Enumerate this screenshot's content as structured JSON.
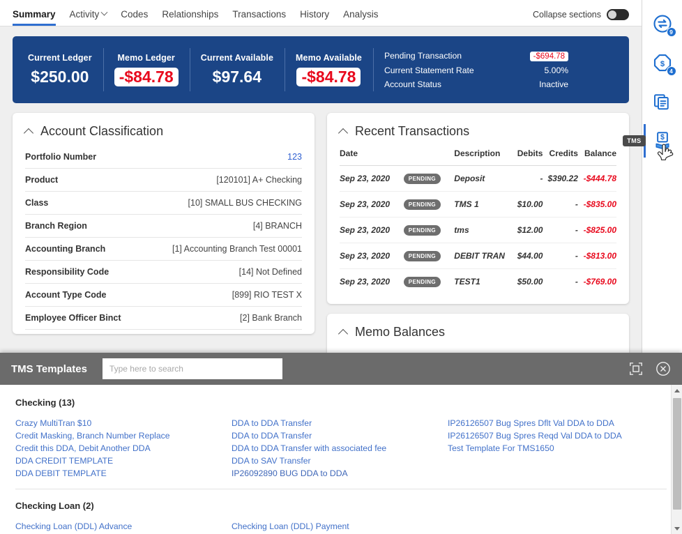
{
  "tabs": [
    {
      "label": "Summary",
      "active": true,
      "caret": false
    },
    {
      "label": "Activity",
      "active": false,
      "caret": true
    },
    {
      "label": "Codes",
      "active": false,
      "caret": false
    },
    {
      "label": "Relationships",
      "active": false,
      "caret": false
    },
    {
      "label": "Transactions",
      "active": false,
      "caret": false
    },
    {
      "label": "History",
      "active": false,
      "caret": false
    },
    {
      "label": "Analysis",
      "active": false,
      "caret": false
    }
  ],
  "header": {
    "collapse_label": "Collapse sections",
    "collapse_state": "off"
  },
  "banner": {
    "accent_color": "#1b4586",
    "negative_color": "#e8081c",
    "cells": [
      {
        "label": "Current Ledger",
        "value": "$250.00",
        "negative": false
      },
      {
        "label": "Memo Ledger",
        "value": "-$84.78",
        "negative": true
      },
      {
        "label": "Current Available",
        "value": "$97.64",
        "negative": false
      },
      {
        "label": "Memo Available",
        "value": "-$84.78",
        "negative": true
      }
    ],
    "info": [
      {
        "key": "Pending Transaction",
        "value": "-$694.78",
        "negative": true
      },
      {
        "key": "Current Statement Rate",
        "value": "5.00%",
        "negative": false
      },
      {
        "key": "Account Status",
        "value": "Inactive",
        "negative": false
      }
    ]
  },
  "account_classification": {
    "title": "Account Classification",
    "rows": [
      {
        "key": "Portfolio Number",
        "value": "123",
        "link": true
      },
      {
        "key": "Product",
        "value": "[120101] A+ Checking",
        "link": false
      },
      {
        "key": "Class",
        "value": "[10] SMALL BUS CHECKING",
        "link": false
      },
      {
        "key": "Branch Region",
        "value": "[4] BRANCH",
        "link": false
      },
      {
        "key": "Accounting Branch",
        "value": "[1] Accounting Branch Test 00001",
        "link": false
      },
      {
        "key": "Responsibility Code",
        "value": "[14] Not Defined",
        "link": false
      },
      {
        "key": "Account Type Code",
        "value": "[899] RIO TEST X",
        "link": false
      },
      {
        "key": "Employee Officer Binct",
        "value": "[2] Bank Branch",
        "link": false
      }
    ]
  },
  "recent_transactions": {
    "title": "Recent Transactions",
    "columns": [
      "Date",
      "Description",
      "Debits",
      "Credits",
      "Balance"
    ],
    "rows": [
      {
        "date": "Sep 23, 2020",
        "status": "PENDING",
        "description": "Deposit",
        "debits": "-",
        "credits": "$390.22",
        "balance": "-$444.78"
      },
      {
        "date": "Sep 23, 2020",
        "status": "PENDING",
        "description": "TMS 1",
        "debits": "$10.00",
        "credits": "-",
        "balance": "-$835.00"
      },
      {
        "date": "Sep 23, 2020",
        "status": "PENDING",
        "description": "tms",
        "debits": "$12.00",
        "credits": "-",
        "balance": "-$825.00"
      },
      {
        "date": "Sep 23, 2020",
        "status": "PENDING",
        "description": "DEBIT TRAN",
        "debits": "$44.00",
        "credits": "-",
        "balance": "-$813.00"
      },
      {
        "date": "Sep 23, 2020",
        "status": "PENDING",
        "description": "TEST1",
        "debits": "$50.00",
        "credits": "-",
        "balance": "-$769.00"
      }
    ]
  },
  "memo_balances": {
    "title": "Memo Balances"
  },
  "rail": {
    "items": [
      {
        "icon": "transfer-icon",
        "badge": "9",
        "active": false,
        "tooltip": ""
      },
      {
        "icon": "dollar-octagon-icon",
        "badge": "4",
        "active": false,
        "tooltip": ""
      },
      {
        "icon": "documents-icon",
        "badge": "",
        "active": false,
        "tooltip": ""
      },
      {
        "icon": "tms-dollar-icon",
        "badge": "",
        "active": true,
        "tooltip": "TMS"
      }
    ]
  },
  "overlay": {
    "title": "TMS Templates",
    "search_placeholder": "Type here to search",
    "search_value": "",
    "maximize_icon": "maximize-icon",
    "close_icon": "close-circle-icon",
    "groups": [
      {
        "title": "Checking (13)",
        "columns": [
          [
            "Crazy MultiTran $10",
            "Credit Masking, Branch Number Replace",
            "Credit this DDA, Debit Another DDA",
            "DDA CREDIT TEMPLATE",
            "DDA DEBIT TEMPLATE"
          ],
          [
            "DDA to DDA Transfer",
            "DDA to DDA Transfer",
            "DDA to DDA Transfer with associated fee",
            "DDA to SAV Transfer",
            "IP26092890 BUG DDA to DDA"
          ],
          [
            "IP26126507 Bug Spres Dflt Val DDA to DDA",
            "IP26126507 Bug Spres Reqd Val DDA to DDA",
            "Test Template For TMS1650"
          ]
        ]
      },
      {
        "title": "Checking Loan (2)",
        "columns": [
          [
            "Checking Loan (DDL) Advance"
          ],
          [
            "Checking Loan (DDL) Payment"
          ],
          []
        ]
      }
    ]
  }
}
